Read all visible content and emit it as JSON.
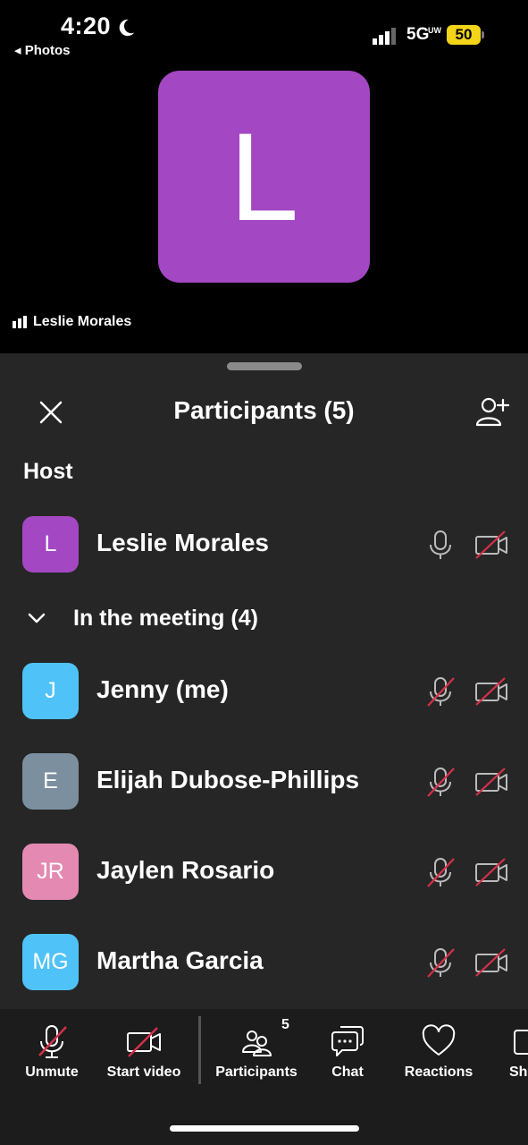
{
  "status_bar": {
    "time": "4:20",
    "back_app": "◂ Photos",
    "network": "5G",
    "network_sup": "UW",
    "battery": "50"
  },
  "video": {
    "avatar_letter": "L",
    "avatar_color": "#a347c2",
    "speaker_name": "Leslie Morales"
  },
  "sheet": {
    "title": "Participants (5)",
    "host_section": "Host",
    "meeting_section": "In the meeting (4)"
  },
  "host": {
    "initials": "L",
    "name": "Leslie Morales",
    "color": "#a347c2",
    "mic": "on",
    "video": "off"
  },
  "participants": [
    {
      "initials": "J",
      "name": "Jenny  (me)",
      "color": "#4fc3f7",
      "mic": "muted",
      "video": "off"
    },
    {
      "initials": "E",
      "name": "Elijah Dubose-Phillips",
      "color": "#7c8f9e",
      "mic": "muted",
      "video": "off"
    },
    {
      "initials": "JR",
      "name": "Jaylen Rosario",
      "color": "#e48ab2",
      "mic": "muted",
      "video": "off"
    },
    {
      "initials": "MG",
      "name": "Martha Garcia",
      "color": "#4fc3f7",
      "mic": "muted",
      "video": "off"
    }
  ],
  "toolbar": {
    "unmute": "Unmute",
    "start_video": "Start video",
    "participants": "Participants",
    "participants_count": "5",
    "chat": "Chat",
    "reactions": "Reactions",
    "share": "Sh"
  },
  "colors": {
    "muted_slash": "#d6304a",
    "sheet_bg": "#262626",
    "toolbar_bg": "#1c1c1c"
  }
}
